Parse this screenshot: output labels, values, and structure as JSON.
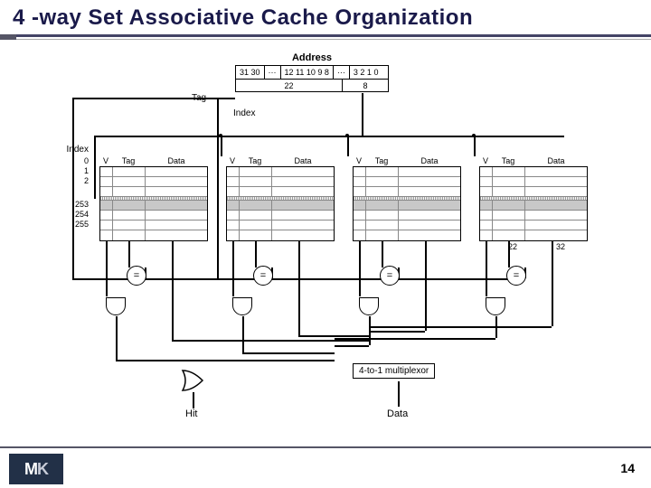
{
  "slide": {
    "title": "4 -way Set Associative Cache Organization",
    "page_number": "14"
  },
  "logo": {
    "m": "M",
    "k": "K"
  },
  "address": {
    "label": "Address",
    "bits": [
      "31 30",
      "···",
      "12 11 10 9 8",
      "···",
      "3 2 1 0"
    ],
    "tag_width": "22",
    "index_width": "8",
    "tag_label": "Tag",
    "index_label": "Index"
  },
  "index_column": {
    "title": "Index",
    "top": [
      "0",
      "1",
      "2"
    ],
    "bottom": [
      "253",
      "254",
      "255"
    ]
  },
  "way_headers": {
    "v": "V",
    "tag": "Tag",
    "data": "Data"
  },
  "bus_widths": {
    "tag": "22",
    "data": "32"
  },
  "mux": {
    "label": "4-to-1 multiplexor"
  },
  "outputs": {
    "hit": "Hit",
    "data": "Data"
  },
  "comparator_symbol": "="
}
